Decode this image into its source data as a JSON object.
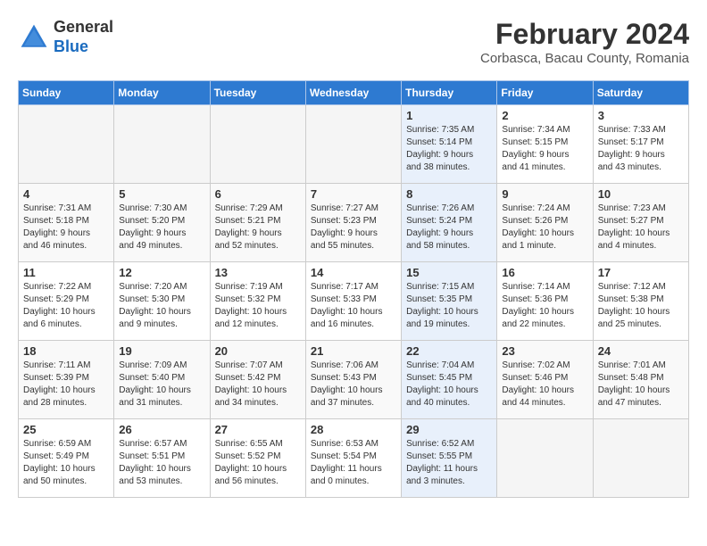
{
  "header": {
    "logo_general": "General",
    "logo_blue": "Blue",
    "month_year": "February 2024",
    "location": "Corbasca, Bacau County, Romania"
  },
  "days_of_week": [
    "Sunday",
    "Monday",
    "Tuesday",
    "Wednesday",
    "Thursday",
    "Friday",
    "Saturday"
  ],
  "weeks": [
    [
      {
        "day": "",
        "info": ""
      },
      {
        "day": "",
        "info": ""
      },
      {
        "day": "",
        "info": ""
      },
      {
        "day": "",
        "info": ""
      },
      {
        "day": "1",
        "info": "Sunrise: 7:35 AM\nSunset: 5:14 PM\nDaylight: 9 hours\nand 38 minutes."
      },
      {
        "day": "2",
        "info": "Sunrise: 7:34 AM\nSunset: 5:15 PM\nDaylight: 9 hours\nand 41 minutes."
      },
      {
        "day": "3",
        "info": "Sunrise: 7:33 AM\nSunset: 5:17 PM\nDaylight: 9 hours\nand 43 minutes."
      }
    ],
    [
      {
        "day": "4",
        "info": "Sunrise: 7:31 AM\nSunset: 5:18 PM\nDaylight: 9 hours\nand 46 minutes."
      },
      {
        "day": "5",
        "info": "Sunrise: 7:30 AM\nSunset: 5:20 PM\nDaylight: 9 hours\nand 49 minutes."
      },
      {
        "day": "6",
        "info": "Sunrise: 7:29 AM\nSunset: 5:21 PM\nDaylight: 9 hours\nand 52 minutes."
      },
      {
        "day": "7",
        "info": "Sunrise: 7:27 AM\nSunset: 5:23 PM\nDaylight: 9 hours\nand 55 minutes."
      },
      {
        "day": "8",
        "info": "Sunrise: 7:26 AM\nSunset: 5:24 PM\nDaylight: 9 hours\nand 58 minutes."
      },
      {
        "day": "9",
        "info": "Sunrise: 7:24 AM\nSunset: 5:26 PM\nDaylight: 10 hours\nand 1 minute."
      },
      {
        "day": "10",
        "info": "Sunrise: 7:23 AM\nSunset: 5:27 PM\nDaylight: 10 hours\nand 4 minutes."
      }
    ],
    [
      {
        "day": "11",
        "info": "Sunrise: 7:22 AM\nSunset: 5:29 PM\nDaylight: 10 hours\nand 6 minutes."
      },
      {
        "day": "12",
        "info": "Sunrise: 7:20 AM\nSunset: 5:30 PM\nDaylight: 10 hours\nand 9 minutes."
      },
      {
        "day": "13",
        "info": "Sunrise: 7:19 AM\nSunset: 5:32 PM\nDaylight: 10 hours\nand 12 minutes."
      },
      {
        "day": "14",
        "info": "Sunrise: 7:17 AM\nSunset: 5:33 PM\nDaylight: 10 hours\nand 16 minutes."
      },
      {
        "day": "15",
        "info": "Sunrise: 7:15 AM\nSunset: 5:35 PM\nDaylight: 10 hours\nand 19 minutes."
      },
      {
        "day": "16",
        "info": "Sunrise: 7:14 AM\nSunset: 5:36 PM\nDaylight: 10 hours\nand 22 minutes."
      },
      {
        "day": "17",
        "info": "Sunrise: 7:12 AM\nSunset: 5:38 PM\nDaylight: 10 hours\nand 25 minutes."
      }
    ],
    [
      {
        "day": "18",
        "info": "Sunrise: 7:11 AM\nSunset: 5:39 PM\nDaylight: 10 hours\nand 28 minutes."
      },
      {
        "day": "19",
        "info": "Sunrise: 7:09 AM\nSunset: 5:40 PM\nDaylight: 10 hours\nand 31 minutes."
      },
      {
        "day": "20",
        "info": "Sunrise: 7:07 AM\nSunset: 5:42 PM\nDaylight: 10 hours\nand 34 minutes."
      },
      {
        "day": "21",
        "info": "Sunrise: 7:06 AM\nSunset: 5:43 PM\nDaylight: 10 hours\nand 37 minutes."
      },
      {
        "day": "22",
        "info": "Sunrise: 7:04 AM\nSunset: 5:45 PM\nDaylight: 10 hours\nand 40 minutes."
      },
      {
        "day": "23",
        "info": "Sunrise: 7:02 AM\nSunset: 5:46 PM\nDaylight: 10 hours\nand 44 minutes."
      },
      {
        "day": "24",
        "info": "Sunrise: 7:01 AM\nSunset: 5:48 PM\nDaylight: 10 hours\nand 47 minutes."
      }
    ],
    [
      {
        "day": "25",
        "info": "Sunrise: 6:59 AM\nSunset: 5:49 PM\nDaylight: 10 hours\nand 50 minutes."
      },
      {
        "day": "26",
        "info": "Sunrise: 6:57 AM\nSunset: 5:51 PM\nDaylight: 10 hours\nand 53 minutes."
      },
      {
        "day": "27",
        "info": "Sunrise: 6:55 AM\nSunset: 5:52 PM\nDaylight: 10 hours\nand 56 minutes."
      },
      {
        "day": "28",
        "info": "Sunrise: 6:53 AM\nSunset: 5:54 PM\nDaylight: 11 hours\nand 0 minutes."
      },
      {
        "day": "29",
        "info": "Sunrise: 6:52 AM\nSunset: 5:55 PM\nDaylight: 11 hours\nand 3 minutes."
      },
      {
        "day": "",
        "info": ""
      },
      {
        "day": "",
        "info": ""
      }
    ]
  ]
}
